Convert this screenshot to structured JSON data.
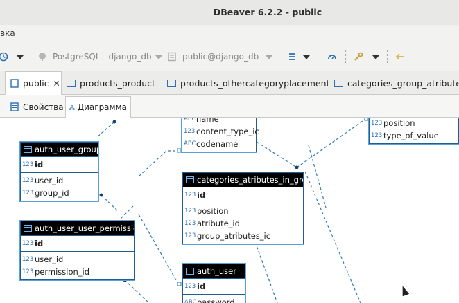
{
  "window": {
    "title": "DBeaver 6.2.2 - public"
  },
  "menubar": {
    "items": [
      "вка"
    ]
  },
  "toolbar": {
    "connection": "PostgreSQL - django_db",
    "schema": "public@django_db"
  },
  "editor_tabs": [
    {
      "label": "public",
      "active": true
    },
    {
      "label": "products_product",
      "active": false
    },
    {
      "label": "products_othercategoryplacement",
      "active": false
    },
    {
      "label": "categories_group_atributes_i",
      "active": false
    }
  ],
  "sub_tabs": [
    {
      "label": "Свойства",
      "active": false
    },
    {
      "label": "Диаграмма",
      "active": true
    }
  ],
  "entities": {
    "top_partial": {
      "rows": [
        {
          "type": "ABC",
          "name": "name"
        },
        {
          "type": "123",
          "name": "content_type_ic"
        },
        {
          "type": "ABC",
          "name": "codename"
        }
      ]
    },
    "right_partial": {
      "rows": [
        {
          "type": "123",
          "name": "position"
        },
        {
          "type": "123",
          "name": "type_of_value"
        }
      ]
    },
    "auth_user_groups": {
      "title": "auth_user_groups",
      "pk": {
        "type": "123",
        "name": "id"
      },
      "rows": [
        {
          "type": "123",
          "name": "user_id"
        },
        {
          "type": "123",
          "name": "group_id"
        }
      ]
    },
    "categories_atributes_in_group": {
      "title": "categories_atributes_in_group",
      "pk": {
        "type": "123",
        "name": "id"
      },
      "rows": [
        {
          "type": "123",
          "name": "position"
        },
        {
          "type": "123",
          "name": "atribute_id"
        },
        {
          "type": "123",
          "name": "group_atributes_ic"
        }
      ]
    },
    "auth_user_user_permissions": {
      "title": "auth_user_user_permissions",
      "pk": {
        "type": "123",
        "name": "id"
      },
      "rows": [
        {
          "type": "123",
          "name": "user_id"
        },
        {
          "type": "123",
          "name": "permission_id"
        }
      ]
    },
    "auth_user": {
      "title": "auth_user",
      "pk": {
        "type": "123",
        "name": "id"
      },
      "rows": [
        {
          "type": "ABC",
          "name": "password"
        }
      ]
    }
  },
  "colors": {
    "header_bg": "#000000",
    "entity_border": "#1f5d92",
    "link_line": "#2e7db5",
    "accent": "#2b6fb5"
  }
}
